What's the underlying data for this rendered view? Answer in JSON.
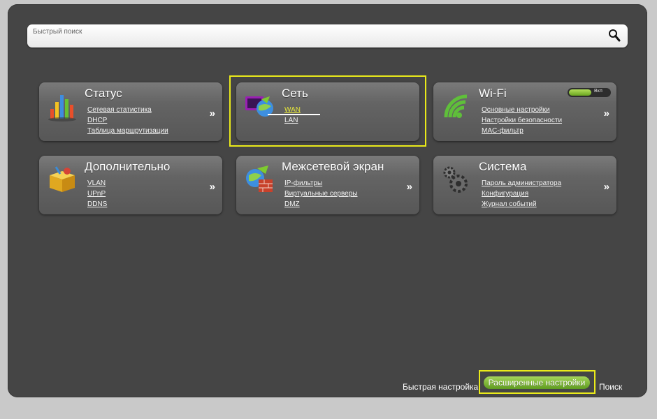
{
  "search": {
    "placeholder": "Быстрый поиск"
  },
  "cards": {
    "status": {
      "title": "Статус",
      "links": [
        "Сетевая статистика",
        "DHCP",
        "Таблица маршрутизации"
      ]
    },
    "network": {
      "title": "Сеть",
      "links": [
        "WAN",
        "LAN"
      ]
    },
    "wifi": {
      "title": "Wi-Fi",
      "links": [
        "Основные настройки",
        "Настройки безопасности",
        "MAC-фильтр"
      ],
      "toggle_label": "Вкл"
    },
    "advanced": {
      "title": "Дополнительно",
      "links": [
        "VLAN",
        "UPnP",
        "DDNS"
      ]
    },
    "firewall": {
      "title": "Межсетевой экран",
      "links": [
        "IP-фильтры",
        "Виртуальные серверы",
        "DMZ"
      ]
    },
    "system": {
      "title": "Система",
      "links": [
        "Пароль администратора",
        "Конфигурация",
        "Журнал событий"
      ]
    }
  },
  "arrow_glyph": "»",
  "footer": {
    "quick_setup": "Быстрая настройка",
    "advanced_settings": "Расширенные настройки",
    "search": "Поиск"
  },
  "colors": {
    "panel": "#454545",
    "highlight": "#eaea1a",
    "accent_green": "#7cbf2c",
    "active_link": "#e8e83a"
  }
}
